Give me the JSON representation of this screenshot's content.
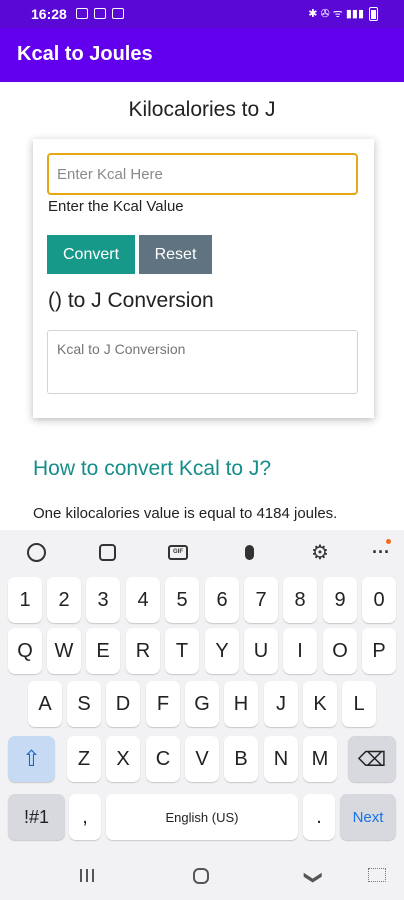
{
  "status_bar": {
    "time": "16:28",
    "right_glyphs": "✱ ✇ ᯤ ▮▮▮"
  },
  "app_bar": {
    "title": "Kcal to Joules"
  },
  "page": {
    "heading": "Kilocalories to J",
    "input_placeholder": "Enter Kcal Here",
    "input_value": "",
    "input_label": "Enter the Kcal Value",
    "convert_label": "Convert",
    "reset_label": "Reset",
    "conversion_heading": "() to J Conversion",
    "result_placeholder": "Kcal to J Conversion",
    "howto_heading": "How to convert Kcal to J?",
    "howto_text": "One kilocalories value is equal to 4184 joules."
  },
  "keyboard": {
    "toolbar_icons": [
      "emoji-icon",
      "sticker-icon",
      "gif-icon",
      "microphone-icon",
      "settings-icon",
      "more-icon"
    ],
    "gif_label": "GIF",
    "settings_glyph": "⚙",
    "more_glyph": "···",
    "row_numbers": [
      "1",
      "2",
      "3",
      "4",
      "5",
      "6",
      "7",
      "8",
      "9",
      "0"
    ],
    "row_top": [
      "Q",
      "W",
      "E",
      "R",
      "T",
      "Y",
      "U",
      "I",
      "O",
      "P"
    ],
    "row_middle": [
      "A",
      "S",
      "D",
      "F",
      "G",
      "H",
      "J",
      "K",
      "L"
    ],
    "row_bottom": [
      "Z",
      "X",
      "C",
      "V",
      "B",
      "N",
      "M"
    ],
    "shift_glyph": "⇧",
    "backspace_glyph": "⌫",
    "symbols_label": "!#1",
    "comma_label": ",",
    "space_label": "English (US)",
    "period_label": ".",
    "action_label": "Next"
  },
  "nav_bar": {
    "back_glyph": "❯"
  },
  "colors": {
    "status_bar": "#5a08d6",
    "app_bar": "#6200ee",
    "convert": "#17998a",
    "reset": "#5f7480",
    "teal_heading": "#168d8b",
    "focus": "#e6a817"
  }
}
